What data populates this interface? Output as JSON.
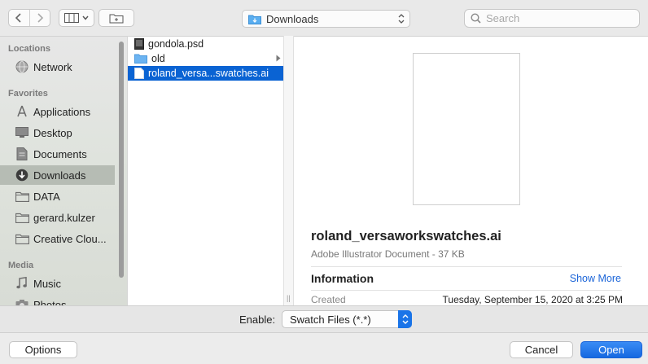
{
  "toolbar": {
    "location": "Downloads",
    "search_placeholder": "Search"
  },
  "sidebar": {
    "sections": {
      "locations": "Locations",
      "favorites": "Favorites",
      "media": "Media"
    },
    "items": [
      {
        "label": "Network",
        "icon": "globe-icon"
      },
      {
        "label": "Applications",
        "icon": "applications-icon"
      },
      {
        "label": "Desktop",
        "icon": "desktop-icon"
      },
      {
        "label": "Documents",
        "icon": "document-icon"
      },
      {
        "label": "Downloads",
        "icon": "download-icon",
        "selected": true
      },
      {
        "label": "DATA",
        "icon": "folder-icon"
      },
      {
        "label": "gerard.kulzer",
        "icon": "folder-icon"
      },
      {
        "label": "Creative Clou...",
        "icon": "folder-icon"
      },
      {
        "label": "Music",
        "icon": "music-icon"
      },
      {
        "label": "Photos",
        "icon": "camera-icon"
      }
    ]
  },
  "files": [
    {
      "name": "gondola.psd",
      "icon": "psd-file-icon"
    },
    {
      "name": "old",
      "icon": "folder-icon",
      "has_children": true
    },
    {
      "name": "roland_versa...swatches.ai",
      "icon": "ai-file-icon",
      "selected": true
    }
  ],
  "preview": {
    "title": "roland_versaworkswatches.ai",
    "subtitle": "Adobe Illustrator Document - 37 KB",
    "info_heading": "Information",
    "show_more": "Show More",
    "created_label": "Created",
    "created_value": "Tuesday, September 15, 2020 at 3:25 PM"
  },
  "enable": {
    "label": "Enable:",
    "value": "Swatch Files (*.*)"
  },
  "buttons": {
    "options": "Options",
    "cancel": "Cancel",
    "open": "Open"
  },
  "colors": {
    "accent": "#1a74e8",
    "selection": "#0a63d3",
    "link": "#1a64d8"
  }
}
